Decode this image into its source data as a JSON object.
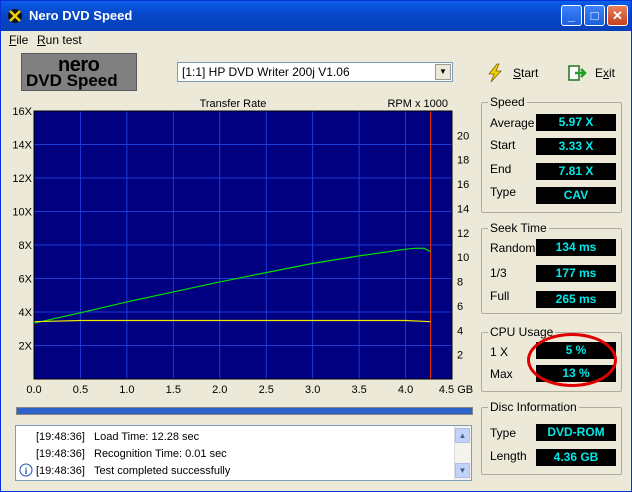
{
  "window": {
    "title": "Nero DVD Speed"
  },
  "menu": {
    "file": "File",
    "file_key": "F",
    "file_rest": "ile",
    "run_key": "R",
    "run_rest": "un test"
  },
  "logo": {
    "line1": "nero",
    "line2": "DVD Speed"
  },
  "drive": {
    "selected": "[1:1]  HP DVD Writer 200j V1.06"
  },
  "buttons": {
    "start_key": "S",
    "start_rest": "tart",
    "exit_key": "x",
    "exit_pre": "E",
    "exit_rest": "it"
  },
  "chart_data": {
    "type": "line",
    "title": "Transfer Rate",
    "right_label": "RPM x 1000",
    "x_unit": "GB",
    "xlim": [
      0,
      4.5
    ],
    "ylim_left": [
      0,
      16
    ],
    "ylim_right": [
      0,
      22
    ],
    "x_ticks": [
      "0.0",
      "0.5",
      "1.0",
      "1.5",
      "2.0",
      "2.5",
      "3.0",
      "3.5",
      "4.0",
      "4.5 GB"
    ],
    "y_ticks_left": [
      "2X",
      "4X",
      "6X",
      "8X",
      "10X",
      "12X",
      "14X",
      "16X"
    ],
    "y_ticks_right": [
      "2",
      "4",
      "6",
      "8",
      "10",
      "12",
      "14",
      "16",
      "18",
      "20"
    ],
    "end_marker_x": 4.27,
    "series": [
      {
        "color": "#00e000",
        "x": [
          0,
          0.5,
          1.0,
          1.5,
          2.0,
          2.5,
          3.0,
          3.5,
          4.0,
          4.1,
          4.2,
          4.27
        ],
        "y": [
          3.33,
          3.95,
          4.6,
          5.2,
          5.8,
          6.35,
          6.9,
          7.35,
          7.75,
          7.8,
          7.81,
          7.6
        ],
        "axis": "left"
      },
      {
        "color": "#e8e800",
        "x": [
          0,
          0.5,
          1.0,
          1.5,
          2.0,
          2.5,
          3.0,
          3.5,
          4.0,
          4.27
        ],
        "y": [
          4.7,
          4.8,
          4.8,
          4.8,
          4.8,
          4.8,
          4.8,
          4.8,
          4.8,
          4.7
        ],
        "axis": "right"
      }
    ],
    "grid": true,
    "background": "#000080"
  },
  "progress": {
    "value": 1.0
  },
  "log": [
    {
      "time": "[19:48:36]",
      "msg": "Load Time: 12.28 sec"
    },
    {
      "time": "[19:48:36]",
      "msg": "Recognition Time: 0.01 sec"
    },
    {
      "time": "[19:48:36]",
      "msg": "Test completed successfully"
    }
  ],
  "speed": {
    "title": "Speed",
    "average_label": "Average",
    "average": "5.97 X",
    "start_label": "Start",
    "start": "3.33 X",
    "end_label": "End",
    "end": "7.81 X",
    "type_label": "Type",
    "type": "CAV"
  },
  "seek": {
    "title": "Seek Time",
    "random_label": "Random",
    "random": "134 ms",
    "third_label": "1/3",
    "third": "177 ms",
    "full_label": "Full",
    "full": "265 ms"
  },
  "cpu": {
    "title": "CPU Usage",
    "x1_label": "1 X",
    "x1": "5 %",
    "max_label": "Max",
    "max": "13 %"
  },
  "disc": {
    "title": "Disc Information",
    "type_label": "Type",
    "type": "DVD-ROM",
    "length_label": "Length",
    "length": "4.36 GB"
  }
}
